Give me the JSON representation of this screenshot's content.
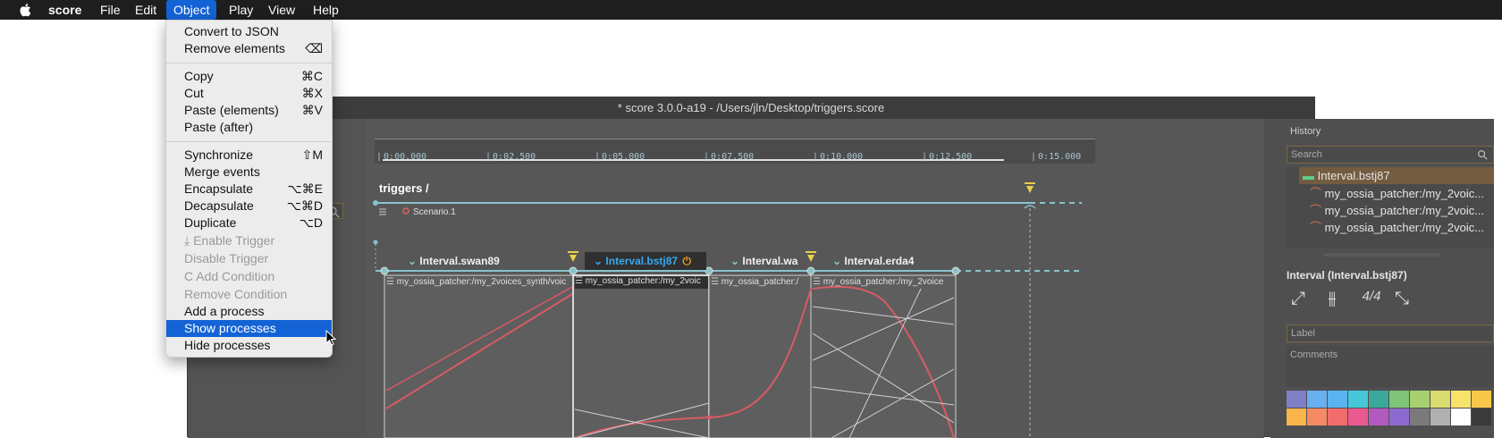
{
  "menubar": {
    "app_name": "score",
    "items": [
      "File",
      "Edit",
      "Object",
      "Play",
      "View",
      "Help"
    ],
    "active": "Object"
  },
  "window": {
    "title": "* score 3.0.0-a19 - /Users/jln/Desktop/triggers.score"
  },
  "dropdown": {
    "items": [
      {
        "label": "Convert to JSON",
        "shortcut": ""
      },
      {
        "label": "Remove elements",
        "shortcut": "⌫"
      },
      {
        "label": "Copy",
        "shortcut": "⌘C"
      },
      {
        "label": "Cut",
        "shortcut": "⌘X"
      },
      {
        "label": "Paste (elements)",
        "shortcut": "⌘V"
      },
      {
        "label": "Paste (after)",
        "shortcut": ""
      },
      {
        "label": "Synchronize",
        "shortcut": "⇧M"
      },
      {
        "label": "Merge events",
        "shortcut": ""
      },
      {
        "label": "Encapsulate",
        "shortcut": "⌥⌘E"
      },
      {
        "label": "Decapsulate",
        "shortcut": "⌥⌘D"
      },
      {
        "label": "Duplicate",
        "shortcut": "⌥D"
      },
      {
        "label": "Enable Trigger",
        "shortcut": ""
      },
      {
        "label": "Disable Trigger",
        "shortcut": ""
      },
      {
        "label": "Add Condition",
        "shortcut": ""
      },
      {
        "label": "Remove Condition",
        "shortcut": ""
      },
      {
        "label": "Add a process",
        "shortcut": ""
      },
      {
        "label": "Show processes",
        "shortcut": ""
      },
      {
        "label": "Hide processes",
        "shortcut": ""
      }
    ]
  },
  "timeline": {
    "ticks": [
      "0:00.000",
      "0:02.500",
      "0:05.000",
      "0:07.500",
      "0:10.000",
      "0:12.500",
      "0:15.000"
    ],
    "scenario_title": "triggers /",
    "scenario_label": "Scenario.1",
    "intervals": [
      {
        "name": "Interval.swan89",
        "process": "my_ossia_patcher:/my_2voices_synth/voic"
      },
      {
        "name": "Interval.bstj87",
        "process": "my_ossia_patcher:/my_2voic"
      },
      {
        "name": "Interval.wa",
        "process": "my_ossia_patcher:/"
      },
      {
        "name": "Interval.erda4",
        "process": "my_ossia_patcher:/my_2voice"
      }
    ]
  },
  "history": {
    "title": "History",
    "search_placeholder": "Search",
    "items": [
      "Interval.bstj87",
      "my_ossia_patcher:/my_2voic...",
      "my_ossia_patcher:/my_2voic...",
      "my_ossia_patcher:/my_2voic..."
    ]
  },
  "inspector": {
    "title": "Interval (Interval.bstj87)",
    "label_placeholder": "Label",
    "comments_placeholder": "Comments",
    "time_signature": "4/4",
    "palette": [
      "#7f7fc7",
      "#68b0f0",
      "#5ab4f0",
      "#46c7d8",
      "#3aa89b",
      "#80c47a",
      "#a8d070",
      "#d8dc6e",
      "#f7e36a",
      "#f9c84a",
      "#f9b44a",
      "#f68a64",
      "#f16c6c",
      "#e95a8f",
      "#b25ac0",
      "#8c6ad0",
      "#7a7a7a",
      "#b0b0b0",
      "#ffffff",
      "#3a3a3a"
    ]
  }
}
